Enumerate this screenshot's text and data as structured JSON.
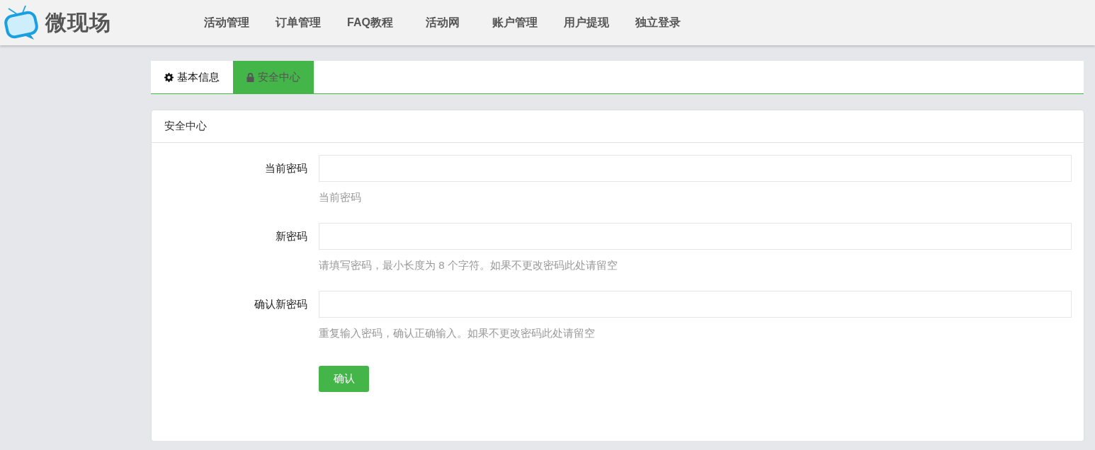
{
  "header": {
    "logo_text": "微现场",
    "nav": [
      {
        "label": "活动管理"
      },
      {
        "label": "订单管理"
      },
      {
        "label": "FAQ教程"
      },
      {
        "label": "活动网"
      },
      {
        "label": "账户管理"
      },
      {
        "label": "用户提现"
      },
      {
        "label": "独立登录"
      }
    ]
  },
  "tabs": [
    {
      "label": "基本信息",
      "kind": "info",
      "selected": false
    },
    {
      "label": "安全中心",
      "kind": "security",
      "selected": true
    }
  ],
  "panel": {
    "title": "安全中心",
    "fields": [
      {
        "label": "当前密码",
        "help": "当前密码"
      },
      {
        "label": "新密码",
        "help": "请填写密码，最小长度为 8 个字符。如果不更改密码此处请留空"
      },
      {
        "label": "确认新密码",
        "help": "重复输入密码，确认正确输入。如果不更改密码此处请留空"
      }
    ],
    "submit": "确认"
  }
}
